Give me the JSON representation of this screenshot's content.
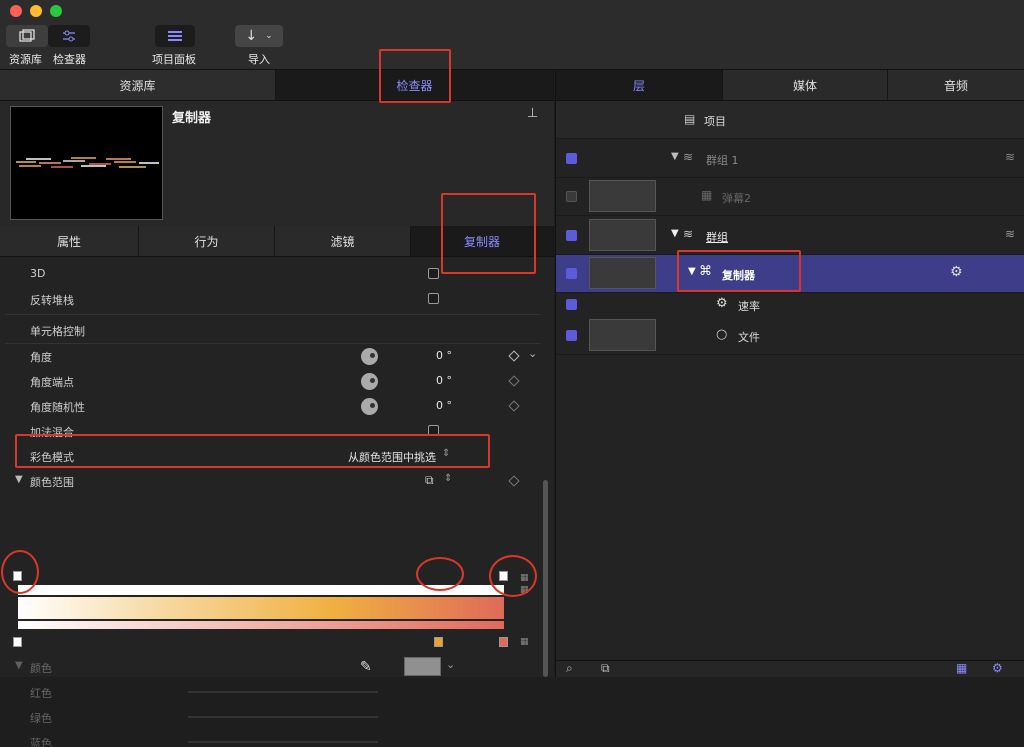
{
  "toolbar": {
    "library_label": "资源库",
    "inspector_label": "检查器",
    "project_panel_label": "项目面板",
    "import_label": "导入"
  },
  "left_tabs": [
    "资源库",
    "检查器"
  ],
  "preview": {
    "title": "复制器"
  },
  "inspector_tabs": [
    "属性",
    "行为",
    "滤镜",
    "复制器"
  ],
  "params": {
    "three_d": "3D",
    "reverse_stack": "反转堆栈",
    "cell_controls": "单元格控制",
    "angle": "角度",
    "angle_value": "0 °",
    "angle_end": "角度端点",
    "angle_end_value": "0 °",
    "angle_random": "角度随机性",
    "angle_random_value": "0 °",
    "additive_blend": "加法混合",
    "color_mode": "彩色模式",
    "color_mode_value": "从颜色范围中挑选",
    "color_range": "颜色范围",
    "color": "颜色",
    "red": "红色",
    "green": "绿色",
    "blue": "蓝色"
  },
  "right_tabs": [
    "层",
    "媒体",
    "音频"
  ],
  "layers": {
    "project": "项目",
    "group1": "群组 1",
    "barrage2": "弹幕2",
    "group": "群组",
    "replicator": "复制器",
    "rate": "速率",
    "file": "文件"
  },
  "colors": {
    "accent": "#8a8aff",
    "selected_row": "#3d3d8a",
    "annotation": "#d9372a",
    "gradient_start": "#ffffff",
    "gradient_mid": "#f0b040",
    "gradient_end": "#e06a5a"
  }
}
